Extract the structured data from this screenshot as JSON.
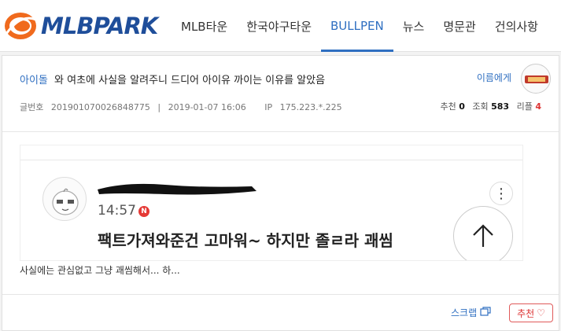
{
  "site": {
    "logo_text": "MLBPARK",
    "brand_color": "#1f4e9a",
    "accent_orange": "#f06a1d"
  },
  "nav": {
    "items": [
      {
        "label": "MLB타운"
      },
      {
        "label": "한국야구타운"
      },
      {
        "label": "BULLPEN",
        "active": true
      },
      {
        "label": "뉴스"
      },
      {
        "label": "명문관"
      },
      {
        "label": "건의사항"
      }
    ]
  },
  "post": {
    "category": "아이돌",
    "title": "와 여초에 사실을 알려주니 드디어 아이유 까이는 이유를 알았음",
    "author": "이름에게",
    "meta": {
      "post_number_label": "글번호",
      "post_number": "201901070026848775",
      "datetime": "2019-01-07 16:06",
      "ip_label": "IP",
      "ip": "175.223.*.225"
    },
    "stats": {
      "recommend_label": "추천",
      "recommend": "0",
      "views_label": "조회",
      "views": "583",
      "replies_label": "리플",
      "replies": "4"
    },
    "embedded": {
      "time": "14:57",
      "badge": "N",
      "text": "팩트가져와준건 고마워~ 하지만 졸ㄹ라 괘씸"
    },
    "body": "사실에는 관심없고 그냥 괘씸해서... 하...",
    "actions": {
      "scrap": "스크랩",
      "recommend": "추천"
    }
  }
}
